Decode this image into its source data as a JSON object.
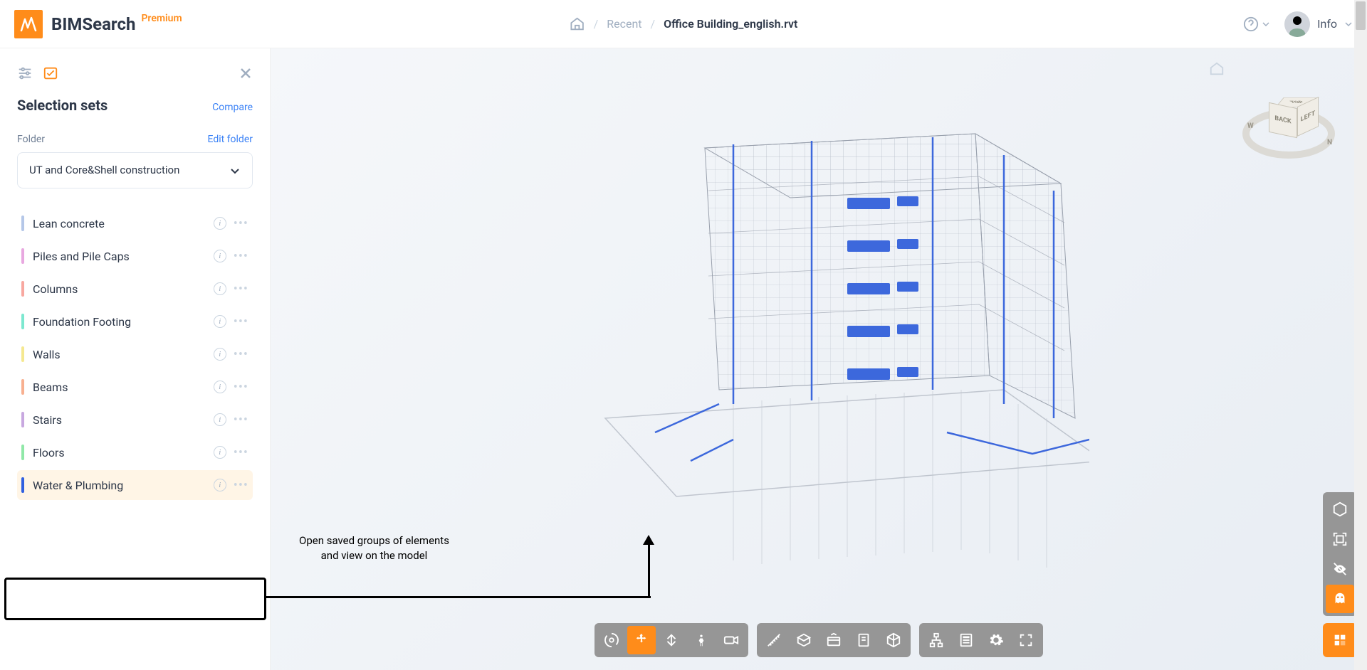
{
  "header": {
    "app_name": "BIMSearch",
    "badge": "Premium",
    "breadcrumb": {
      "recent": "Recent",
      "current": "Office Building_english.rvt"
    },
    "user_label": "Info"
  },
  "sidebar": {
    "panel_title": "Selection sets",
    "compare": "Compare",
    "folder_label": "Folder",
    "edit_folder": "Edit folder",
    "folder_selected": "UT and Core&Shell construction",
    "sets": [
      {
        "name": "Lean concrete",
        "color": "#b5c7e8",
        "selected": false
      },
      {
        "name": "Piles and Pile Caps",
        "color": "#e8a8e0",
        "selected": false
      },
      {
        "name": "Columns",
        "color": "#f8a8a0",
        "selected": false
      },
      {
        "name": "Foundation Footing",
        "color": "#7de8d0",
        "selected": false
      },
      {
        "name": "Walls",
        "color": "#f5e890",
        "selected": false
      },
      {
        "name": "Beams",
        "color": "#f8b090",
        "selected": false
      },
      {
        "name": "Stairs",
        "color": "#c8a8e0",
        "selected": false
      },
      {
        "name": "Floors",
        "color": "#90e8a8",
        "selected": false
      },
      {
        "name": "Water & Plumbing",
        "color": "#3060e0",
        "selected": true
      }
    ]
  },
  "annotation": {
    "line1": "Open saved groups of elements",
    "line2": "and view on the model"
  },
  "viewcube": {
    "top": "TOP",
    "back": "BACK",
    "left": "LEFT"
  }
}
